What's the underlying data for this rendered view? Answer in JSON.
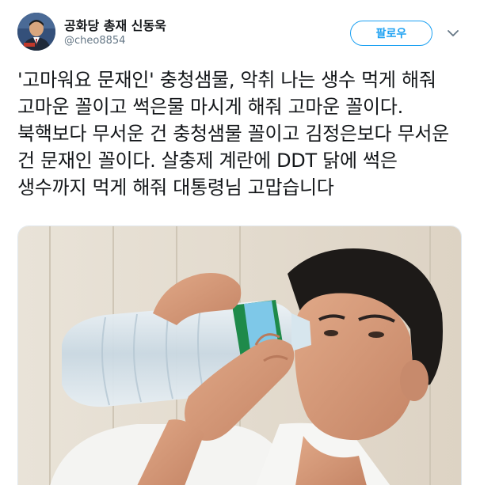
{
  "profile": {
    "display_name": "공화당 총재 신동욱",
    "handle": "@cheo8854"
  },
  "actions": {
    "follow_label": "팔로우"
  },
  "tweet": {
    "text": "'고마워요 문재인' 충청샘물, 악취 나는 생수 먹게 해줘 고마운 꼴이고 썩은물 마시게 해줘 고마운 꼴이다. 북핵보다 무서운 건 충청샘물 꼴이고 김정은보다 무서운 건 문재인 꼴이다. 살충제 계란에 DDT 닭에 썩은 생수까지 먹게 해줘 대통령님 고맙습니다"
  },
  "icons": {
    "caret": "chevron-down-icon"
  },
  "colors": {
    "accent": "#1da1f2",
    "text_primary": "#14171a",
    "text_secondary": "#657786"
  }
}
